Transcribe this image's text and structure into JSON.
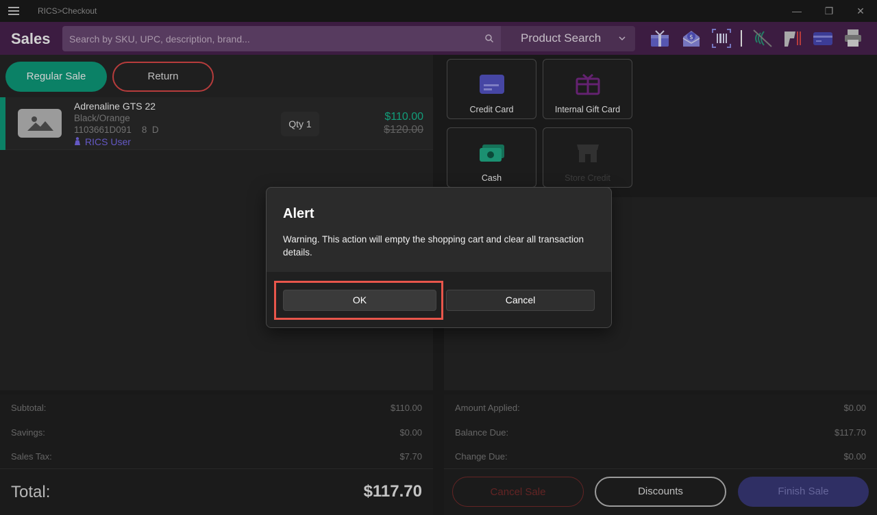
{
  "window": {
    "title": "RICS>Checkout",
    "minimize_glyph": "—",
    "maximize_glyph": "❐",
    "close_glyph": "✕"
  },
  "header": {
    "brand": "Sales",
    "search_placeholder": "Search by SKU, UPC, description, brand...",
    "product_search_label": "Product Search",
    "icons": [
      "gift-icon",
      "mail-money-icon",
      "barcode-scan-icon",
      "contactless-off-icon",
      "scanner-icon",
      "card-reader-icon",
      "printer-icon"
    ]
  },
  "mode_buttons": {
    "regular_sale": "Regular Sale",
    "return": "Return"
  },
  "cart": {
    "items": [
      {
        "name": "Adrenaline GTS 22",
        "color": "Black/Orange",
        "sku": "1103661D091",
        "size": "8",
        "width": "D",
        "user": "RICS User",
        "qty": "Qty 1",
        "price": "$110.00",
        "original_price": "$120.00"
      }
    ]
  },
  "payment_tiles": {
    "credit_card": "Credit Card",
    "internal_gift_card": "Internal Gift Card",
    "cash": "Cash",
    "store_credit": "Store Credit"
  },
  "totals": {
    "subtotal_label": "Subtotal:",
    "subtotal": "$110.00",
    "savings_label": "Savings:",
    "savings": "$0.00",
    "tax_label": "Sales Tax:",
    "tax": "$7.70",
    "total_label": "Total:",
    "total": "$117.70"
  },
  "payment_summary": {
    "applied_label": "Amount Applied:",
    "applied": "$0.00",
    "balance_label": "Balance Due:",
    "balance": "$117.70",
    "change_label": "Change Due:",
    "change": "$0.00"
  },
  "actions": {
    "cancel_sale": "Cancel Sale",
    "discounts": "Discounts",
    "finish_sale": "Finish Sale"
  },
  "dialog": {
    "title": "Alert",
    "message": "Warning. This action will empty the shopping cart and clear all transaction details.",
    "ok": "OK",
    "cancel": "Cancel"
  },
  "colors": {
    "header_bg": "#4a2350",
    "accent_green": "#0e9e7d",
    "return_red": "#e04a4a",
    "user_blue": "#7a6cf0",
    "highlight_red": "#e8564b"
  }
}
